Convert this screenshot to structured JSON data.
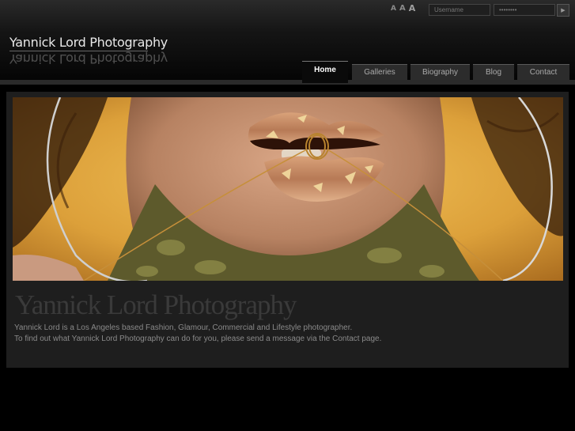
{
  "header": {
    "font_size_options": [
      "A",
      "A",
      "A"
    ],
    "login": {
      "username_placeholder": "Username",
      "password_placeholder": "••••••••",
      "submit_icon": "play-arrow-icon"
    },
    "logo": {
      "title": "Yannick Lord Photography",
      "reflection": "Yannick Lord Photography"
    }
  },
  "nav": {
    "tabs": [
      {
        "label": "Home",
        "active": true
      },
      {
        "label": "Galleries",
        "active": false
      },
      {
        "label": "Biography",
        "active": false
      },
      {
        "label": "Blog",
        "active": false
      },
      {
        "label": "Contact",
        "active": false
      }
    ]
  },
  "main": {
    "title": "Yannick Lord Photography",
    "intro": [
      "Yannick Lord is a Los Angeles based Fashion, Glamour, Commercial and Lifestyle photographer.",
      "To find out what Yannick Lord Photography can do for you, please send a message via the Contact page."
    ]
  },
  "colors": {
    "background": "#000000",
    "panel": "#1e1e1e",
    "hero_backdrop": "#e0a93e",
    "lip_gold": "#c9935a"
  }
}
